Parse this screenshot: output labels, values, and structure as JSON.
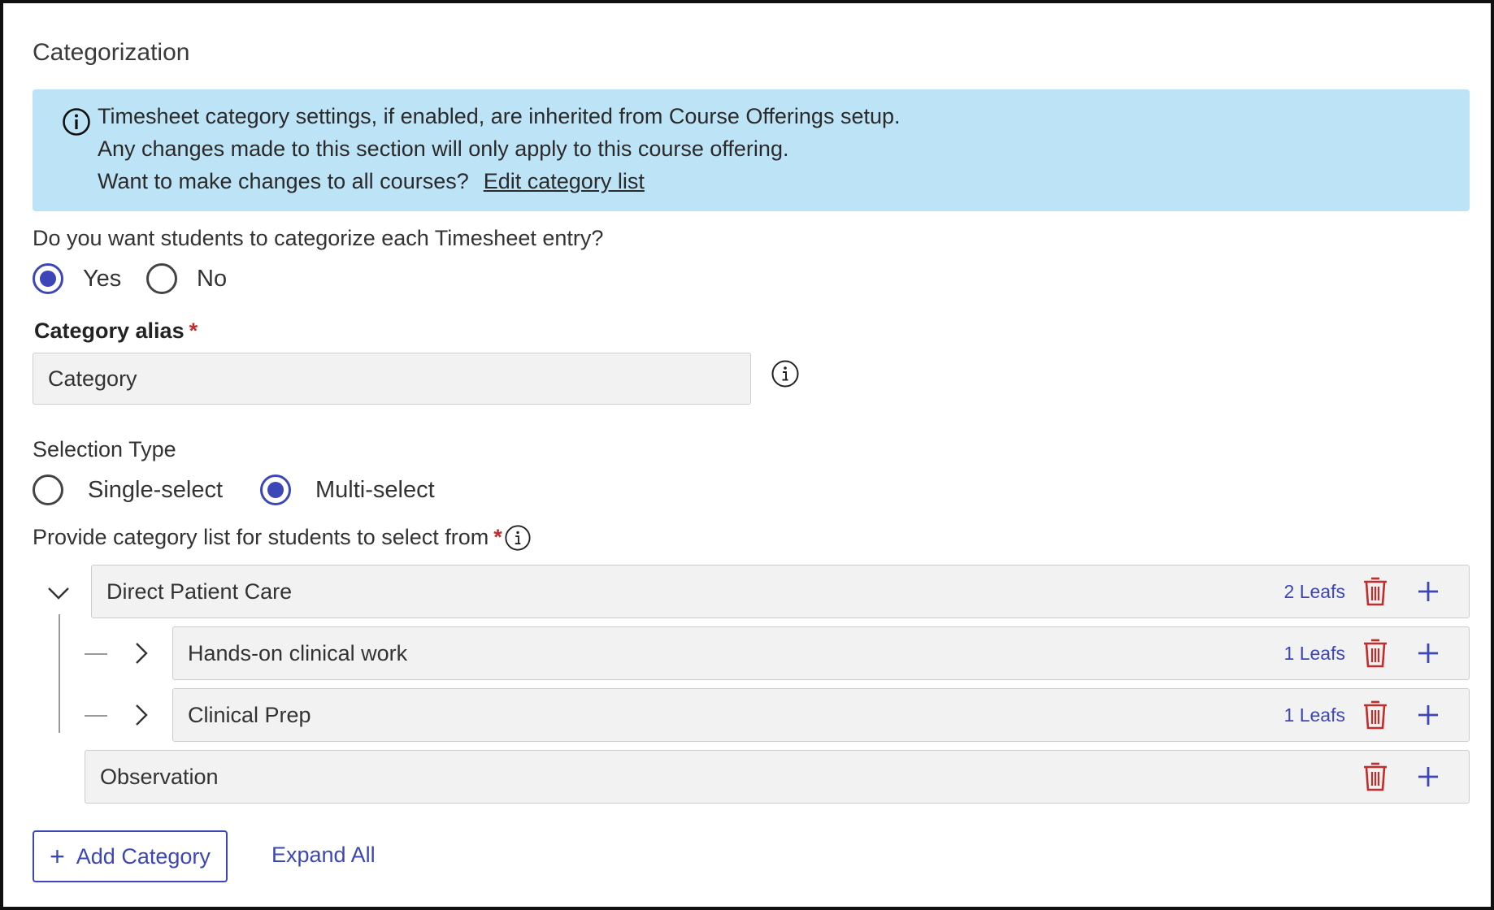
{
  "section_title": "Categorization",
  "banner": {
    "line1": "Timesheet category settings, if enabled, are inherited from Course Offerings setup.",
    "line2": "Any changes made to this section will only apply to this course offering.",
    "line3": "Want to make changes to all courses?",
    "link": "Edit category list",
    "icon": "info-circle-icon"
  },
  "categorize_question": {
    "label": "Do you want students to categorize each Timesheet entry?",
    "options": [
      {
        "label": "Yes",
        "checked": true
      },
      {
        "label": "No",
        "checked": false
      }
    ]
  },
  "category_alias": {
    "label": "Category alias",
    "required_mark": "*",
    "value": "Category",
    "info_icon": "info-circle-icon"
  },
  "selection_type": {
    "label": "Selection Type",
    "options": [
      {
        "label": "Single-select",
        "checked": false
      },
      {
        "label": "Multi-select",
        "checked": true
      }
    ]
  },
  "category_list": {
    "label": "Provide category list for students to select from",
    "required_mark": "*",
    "info_icon": "info-circle-icon",
    "items": [
      {
        "name": "Direct Patient Care",
        "leafs": "2 Leafs",
        "expanded": true,
        "level": 0
      },
      {
        "name": "Hands-on clinical work",
        "leafs": "1 Leafs",
        "expanded": false,
        "level": 1
      },
      {
        "name": "Clinical Prep",
        "leafs": "1 Leafs",
        "expanded": false,
        "level": 1
      },
      {
        "name": "Observation",
        "leafs": "",
        "expanded": false,
        "level": 0
      }
    ]
  },
  "actions": {
    "add_category": "Add Category",
    "expand_all": "Expand All"
  },
  "colors": {
    "accent": "#3d46b8",
    "banner_bg": "#bde3f6",
    "danger": "#c42b2b",
    "field_bg": "#f2f2f2"
  }
}
